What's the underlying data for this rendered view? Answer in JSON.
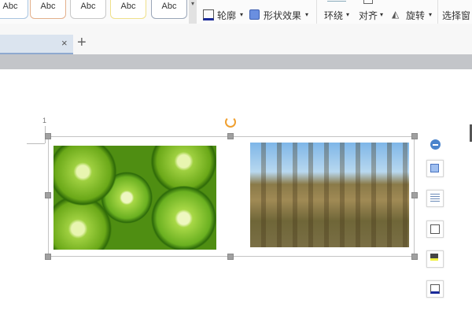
{
  "ribbon": {
    "style_samples": [
      "Abc",
      "Abc",
      "Abc",
      "Abc",
      "Abc"
    ],
    "outline_label": "轮廓",
    "shape_effect_label": "形状效果",
    "wrap_label": "环绕",
    "align_label": "对齐",
    "rotate_label": "旋转",
    "selection_pane_label": "选择窗"
  },
  "tabs": {
    "close": "×",
    "add": "+"
  },
  "document": {
    "ruler_number": "1"
  },
  "colors": {
    "accent": "#4a7fc1",
    "handle": "#a0a0a0",
    "rotate": "#f0a030"
  }
}
